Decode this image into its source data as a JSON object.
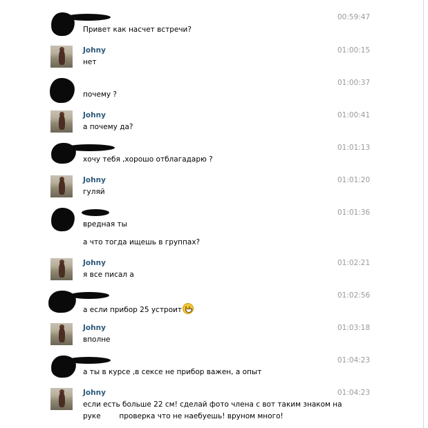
{
  "user_name": "Johny",
  "messages": [
    {
      "from": "other",
      "time": "00:59:47",
      "lines": [
        "Привет как насчет встречи?"
      ]
    },
    {
      "from": "johny",
      "time": "01:00:15",
      "lines": [
        "нет"
      ]
    },
    {
      "from": "other",
      "time": "01:00:37",
      "lines": [
        "почему ?"
      ]
    },
    {
      "from": "johny",
      "time": "01:00:41",
      "lines": [
        "а почему да?"
      ]
    },
    {
      "from": "other",
      "time": "01:01:13",
      "lines": [
        "хочу тебя ,хорошо отблагадарю ?"
      ]
    },
    {
      "from": "johny",
      "time": "01:01:20",
      "lines": [
        "гуляй"
      ]
    },
    {
      "from": "other",
      "time": "01:01:36",
      "lines": [
        "вредная ты",
        "а что тогда ищешь в группах?"
      ]
    },
    {
      "from": "johny",
      "time": "01:02:21",
      "lines": [
        "я все писал а"
      ]
    },
    {
      "from": "other",
      "time": "01:02:56",
      "lines": [
        "а если прибор 25 устроит"
      ]
    },
    {
      "from": "johny",
      "time": "01:03:18",
      "lines": [
        "вполне"
      ]
    },
    {
      "from": "other",
      "time": "01:04:23",
      "lines": [
        "а ты в курсе ,в сексе не прибор важен, а опыт"
      ]
    },
    {
      "from": "johny",
      "time": "01:04:23",
      "lines": [
        "если есть больше 22 см! сделай фото члена с вот таким знаком на",
        "руке        проверка что не наебуешь! вруном много!"
      ]
    }
  ]
}
